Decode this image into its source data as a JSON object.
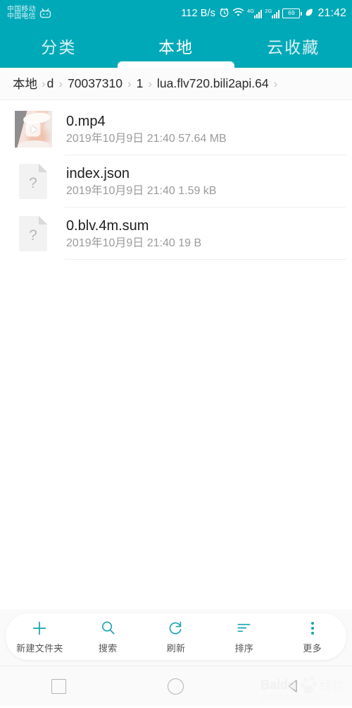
{
  "status_bar": {
    "carrier_primary": "中国移动",
    "carrier_secondary": "中国电信",
    "app_icon": "bilibili-tv-icon",
    "network_speed": "112 B/s",
    "alarm_icon": "alarm-clock-icon",
    "wifi_icon": "wifi-icon",
    "signal_1_label": "4G",
    "signal_2_label": "2G",
    "battery_level": "69",
    "charging_icon": "battery-charging-leaf-icon",
    "time": "21:42"
  },
  "tabs": [
    {
      "label": "分类",
      "active": false,
      "name": "tab-category"
    },
    {
      "label": "本地",
      "active": true,
      "name": "tab-local"
    },
    {
      "label": "云收藏",
      "active": false,
      "name": "tab-cloud-favorites"
    }
  ],
  "breadcrumb": {
    "items": [
      "本地",
      "d",
      "70037310",
      "1",
      "lua.flv720.bili2api.64"
    ],
    "separator": "›",
    "overflow_indicator": "›"
  },
  "files": [
    {
      "name": "0.mp4",
      "date": "2019年10月9日",
      "time": "21:40",
      "size": "57.64 MB",
      "meta": "2019年10月9日 21:40 57.64 MB",
      "icon": "video-thumbnail-with-play-icon"
    },
    {
      "name": "index.json",
      "date": "2019年10月9日",
      "time": "21:40",
      "size": "1.59 kB",
      "meta": "2019年10月9日 21:40 1.59 kB",
      "icon": "unknown-file-icon"
    },
    {
      "name": "0.blv.4m.sum",
      "date": "2019年10月9日",
      "time": "21:40",
      "size": "19 B",
      "meta": "2019年10月9日 21:40 19 B",
      "icon": "unknown-file-icon"
    }
  ],
  "toolbar": [
    {
      "label": "新建文件夹",
      "icon": "plus-icon",
      "name": "new-folder-button"
    },
    {
      "label": "搜索",
      "icon": "search-icon",
      "name": "search-button"
    },
    {
      "label": "刷新",
      "icon": "refresh-icon",
      "name": "refresh-button"
    },
    {
      "label": "排序",
      "icon": "sort-icon",
      "name": "sort-button"
    },
    {
      "label": "更多",
      "icon": "more-vertical-icon",
      "name": "more-button"
    }
  ],
  "nav_bar": {
    "recents": "recents-square-icon",
    "home": "home-circle-icon",
    "back": "back-triangle-icon"
  },
  "watermark": {
    "brand": "Baidu",
    "text": "经验",
    "url": "jingyan.baidu.com"
  },
  "colors": {
    "accent": "#00a9b8",
    "toolbar_icon": "#17a2ae",
    "file_name": "#1f1f1f",
    "file_meta": "#9b9b9b"
  }
}
